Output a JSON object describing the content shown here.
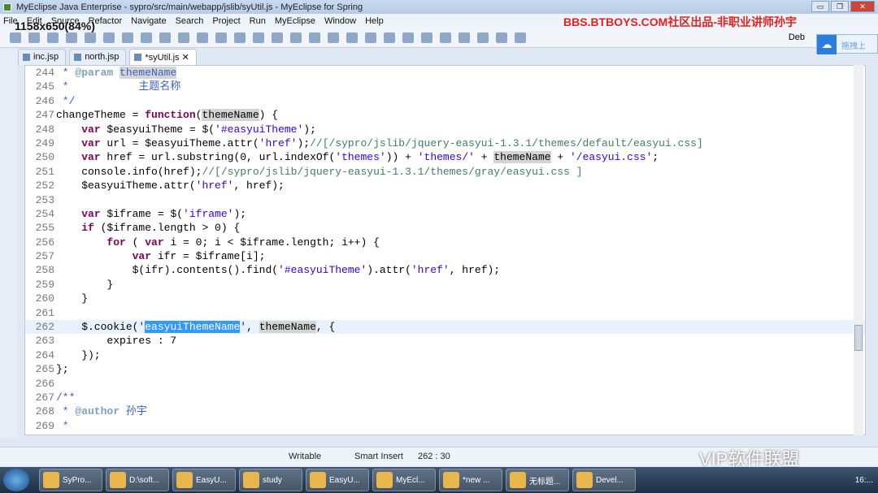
{
  "window": {
    "title": "MyEclipse Java Enterprise - sypro/src/main/webapp/jslib/syUtil.js - MyEclipse for Spring",
    "buttons": [
      "▭",
      "❐",
      "✕"
    ]
  },
  "overlay": {
    "banner": "BBS.BTBOYS.COM社区出品-非职业讲师孙宇",
    "size_info": "1158x650(84%)",
    "cloud_label": "拖拽上",
    "watermark": "VIP软件联盟"
  },
  "menu": [
    "File",
    "Edit",
    "Source",
    "Refactor",
    "Navigate",
    "Search",
    "Project",
    "Run",
    "MyEclipse",
    "Window",
    "Help"
  ],
  "toolbar": {
    "perspective": "Deb"
  },
  "tabs": [
    {
      "label": "inc.jsp"
    },
    {
      "label": "north.jsp"
    },
    {
      "label": "*syUtil.js ✕",
      "active": true
    }
  ],
  "editor": {
    "current_line": 262,
    "lines": [
      {
        "n": 244,
        "t": [
          [
            " * ",
            "d"
          ],
          [
            "@param",
            "t"
          ],
          [
            " ",
            ""
          ],
          [
            "themeName",
            "d h"
          ]
        ]
      },
      {
        "n": 245,
        "t": [
          [
            " *           主题名称",
            "d"
          ]
        ]
      },
      {
        "n": 246,
        "t": [
          [
            " */",
            "d"
          ]
        ]
      },
      {
        "n": 247,
        "t": [
          [
            "changeTheme = ",
            ""
          ],
          [
            "function",
            "k"
          ],
          [
            "(",
            ""
          ],
          [
            "themeName",
            "h"
          ],
          [
            ") {",
            ""
          ]
        ]
      },
      {
        "n": 248,
        "t": [
          [
            "    ",
            ""
          ],
          [
            "var",
            "k"
          ],
          [
            " $easyuiTheme = $(",
            ""
          ],
          [
            "'#easyuiTheme'",
            "s"
          ],
          [
            ");",
            ""
          ]
        ]
      },
      {
        "n": 249,
        "t": [
          [
            "    ",
            ""
          ],
          [
            "var",
            "k"
          ],
          [
            " url = $easyuiTheme.attr(",
            ""
          ],
          [
            "'href'",
            "s"
          ],
          [
            ");",
            ""
          ],
          [
            "//[/sypro/jslib/jquery-easyui-1.3.1/themes/default/easyui.css]",
            "c"
          ]
        ]
      },
      {
        "n": 250,
        "t": [
          [
            "    ",
            ""
          ],
          [
            "var",
            "k"
          ],
          [
            " href = url.substring(0, url.indexOf(",
            ""
          ],
          [
            "'themes'",
            "s"
          ],
          [
            ")) + ",
            ""
          ],
          [
            "'themes/'",
            "s"
          ],
          [
            " + ",
            ""
          ],
          [
            "themeName",
            "h"
          ],
          [
            " + ",
            ""
          ],
          [
            "'/easyui.css'",
            "s"
          ],
          [
            ";",
            ""
          ]
        ]
      },
      {
        "n": 251,
        "t": [
          [
            "    console.info(href);",
            ""
          ],
          [
            "//[/sypro/jslib/jquery-easyui-1.3.1/themes/gray/easyui.css ]",
            "c"
          ]
        ]
      },
      {
        "n": 252,
        "t": [
          [
            "    $easyuiTheme.attr(",
            ""
          ],
          [
            "'href'",
            "s"
          ],
          [
            ", href);",
            ""
          ]
        ]
      },
      {
        "n": 253,
        "t": []
      },
      {
        "n": 254,
        "t": [
          [
            "    ",
            ""
          ],
          [
            "var",
            "k"
          ],
          [
            " $iframe = $(",
            ""
          ],
          [
            "'iframe'",
            "s"
          ],
          [
            ");",
            ""
          ]
        ]
      },
      {
        "n": 255,
        "t": [
          [
            "    ",
            ""
          ],
          [
            "if",
            "k"
          ],
          [
            " ($iframe.length > 0) {",
            ""
          ]
        ]
      },
      {
        "n": 256,
        "t": [
          [
            "        ",
            ""
          ],
          [
            "for",
            "k"
          ],
          [
            " ( ",
            ""
          ],
          [
            "var",
            "k"
          ],
          [
            " i = 0; i < $iframe.length; i++) {",
            ""
          ]
        ]
      },
      {
        "n": 257,
        "t": [
          [
            "            ",
            ""
          ],
          [
            "var",
            "k"
          ],
          [
            " ifr = $iframe[i];",
            ""
          ]
        ]
      },
      {
        "n": 258,
        "t": [
          [
            "            $(ifr).contents().find(",
            ""
          ],
          [
            "'#easyuiTheme'",
            "s"
          ],
          [
            ").attr(",
            ""
          ],
          [
            "'href'",
            "s"
          ],
          [
            ", href);",
            ""
          ]
        ]
      },
      {
        "n": 259,
        "t": [
          [
            "        }",
            ""
          ]
        ]
      },
      {
        "n": 260,
        "t": [
          [
            "    }",
            ""
          ]
        ]
      },
      {
        "n": 261,
        "t": []
      },
      {
        "n": 262,
        "t": [
          [
            "    $.cookie(",
            ""
          ],
          [
            "'",
            "s"
          ],
          [
            "easyuiThemeName",
            "sel"
          ],
          [
            "'",
            "s"
          ],
          [
            ", ",
            ""
          ],
          [
            "themeName",
            "h"
          ],
          [
            ", {",
            ""
          ]
        ]
      },
      {
        "n": 263,
        "t": [
          [
            "        expires : 7",
            ""
          ]
        ]
      },
      {
        "n": 264,
        "t": [
          [
            "    });",
            ""
          ]
        ]
      },
      {
        "n": 265,
        "t": [
          [
            "};",
            ""
          ]
        ]
      },
      {
        "n": 266,
        "t": []
      },
      {
        "n": 267,
        "t": [
          [
            "/**",
            "d"
          ]
        ]
      },
      {
        "n": 268,
        "t": [
          [
            " * ",
            "d"
          ],
          [
            "@author",
            "t"
          ],
          [
            " 孙宇",
            "d"
          ]
        ]
      },
      {
        "n": 269,
        "t": [
          [
            " *",
            "d"
          ]
        ]
      }
    ]
  },
  "status": {
    "mode": "Writable",
    "insert": "Smart Insert",
    "position": "262 : 30"
  },
  "taskbar": [
    {
      "label": "SyPro..."
    },
    {
      "label": "D:\\soft..."
    },
    {
      "label": "EasyU..."
    },
    {
      "label": "study"
    },
    {
      "label": "EasyU..."
    },
    {
      "label": "MyEcl..."
    },
    {
      "label": "*new ..."
    },
    {
      "label": "无标题..."
    },
    {
      "label": "Devel..."
    }
  ],
  "tray": {
    "clock": "16:..."
  }
}
